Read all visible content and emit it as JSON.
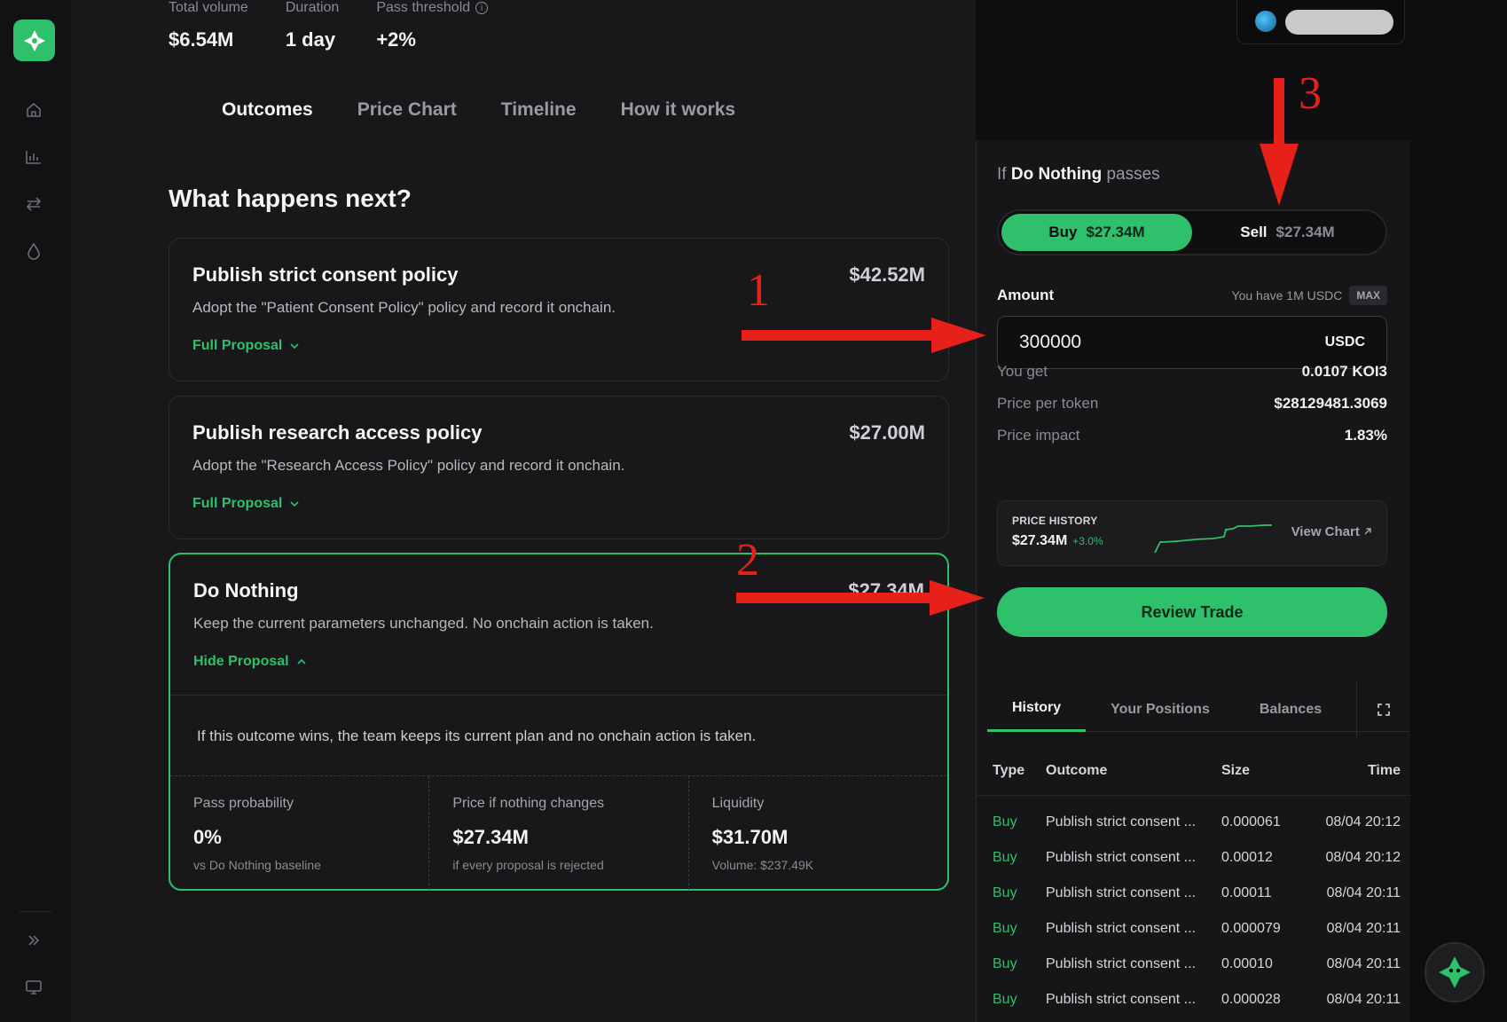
{
  "stats": [
    {
      "label": "Total volume",
      "value": "$6.54M",
      "info": false
    },
    {
      "label": "Duration",
      "value": "1 day",
      "info": false
    },
    {
      "label": "Pass threshold",
      "value": "+2%",
      "info": true
    }
  ],
  "tabs": [
    "Outcomes",
    "Price Chart",
    "Timeline",
    "How it works"
  ],
  "section_title": "What happens next?",
  "outcomes": [
    {
      "title": "Publish strict consent policy",
      "amount": "$42.52M",
      "desc": "Adopt the \"Patient Consent Policy\" policy and record it onchain.",
      "link": "Full Proposal"
    },
    {
      "title": "Publish research access policy",
      "amount": "$27.00M",
      "desc": "Adopt the \"Research Access Policy\" policy and record it onchain.",
      "link": "Full Proposal"
    },
    {
      "title": "Do Nothing",
      "amount": "$27.34M",
      "desc": "Keep the current parameters unchanged. No onchain action is taken.",
      "link": "Hide Proposal",
      "explanation": "If this outcome wins, the team keeps its current plan and no onchain action is taken.",
      "metrics": [
        {
          "label": "Pass probability",
          "value": "0%",
          "sub": "vs Do Nothing baseline"
        },
        {
          "label": "Price if nothing changes",
          "value": "$27.34M",
          "sub": "if every proposal is rejected"
        },
        {
          "label": "Liquidity",
          "value": "$31.70M",
          "sub": "Volume: $237.49K"
        }
      ]
    }
  ],
  "trade": {
    "if_prefix": "If",
    "if_outcome": "Do Nothing",
    "if_suffix": "passes",
    "buy_label": "Buy",
    "buy_price": "$27.34M",
    "sell_label": "Sell",
    "sell_price": "$27.34M",
    "amount_label": "Amount",
    "balance_text": "You have 1M USDC",
    "max_label": "MAX",
    "amount_value": "300000",
    "amount_unit": "USDC",
    "you_get_label": "You get",
    "you_get_value": "0.0107 KOI3",
    "price_per_token_label": "Price per token",
    "price_per_token_value": "$28129481.3069",
    "price_impact_label": "Price impact",
    "price_impact_value": "1.83%",
    "price_history_label": "PRICE HISTORY",
    "price_history_value": "$27.34M",
    "price_history_change": "+3.0%",
    "view_chart_label": "View Chart",
    "review_label": "Review Trade"
  },
  "history": {
    "tabs": [
      "History",
      "Your Positions",
      "Balances"
    ],
    "columns": [
      "Type",
      "Outcome",
      "Size",
      "Time"
    ],
    "rows": [
      {
        "type": "Buy",
        "outcome": "Publish strict consent ...",
        "size": "0.000061",
        "time": "08/04 20:12"
      },
      {
        "type": "Buy",
        "outcome": "Publish strict consent ...",
        "size": "0.00012",
        "time": "08/04 20:12"
      },
      {
        "type": "Buy",
        "outcome": "Publish strict consent ...",
        "size": "0.00011",
        "time": "08/04 20:11"
      },
      {
        "type": "Buy",
        "outcome": "Publish strict consent ...",
        "size": "0.000079",
        "time": "08/04 20:11"
      },
      {
        "type": "Buy",
        "outcome": "Publish strict consent ...",
        "size": "0.00010",
        "time": "08/04 20:11"
      },
      {
        "type": "Buy",
        "outcome": "Publish strict consent ...",
        "size": "0.000028",
        "time": "08/04 20:11"
      }
    ]
  },
  "annotations": [
    "1",
    "2",
    "3"
  ],
  "colors": {
    "accent": "#2ec06a",
    "annotation": "#e8201a",
    "background": "#18181b"
  },
  "icons": [
    "logo-icon",
    "home-icon",
    "markets-icon",
    "swap-icon",
    "drop-icon",
    "expand-sidebar-icon",
    "monitor-icon",
    "info-icon",
    "chevron-down-icon",
    "chevron-up-icon",
    "arrow-up-right-icon",
    "fullscreen-icon",
    "assistant-icon"
  ]
}
